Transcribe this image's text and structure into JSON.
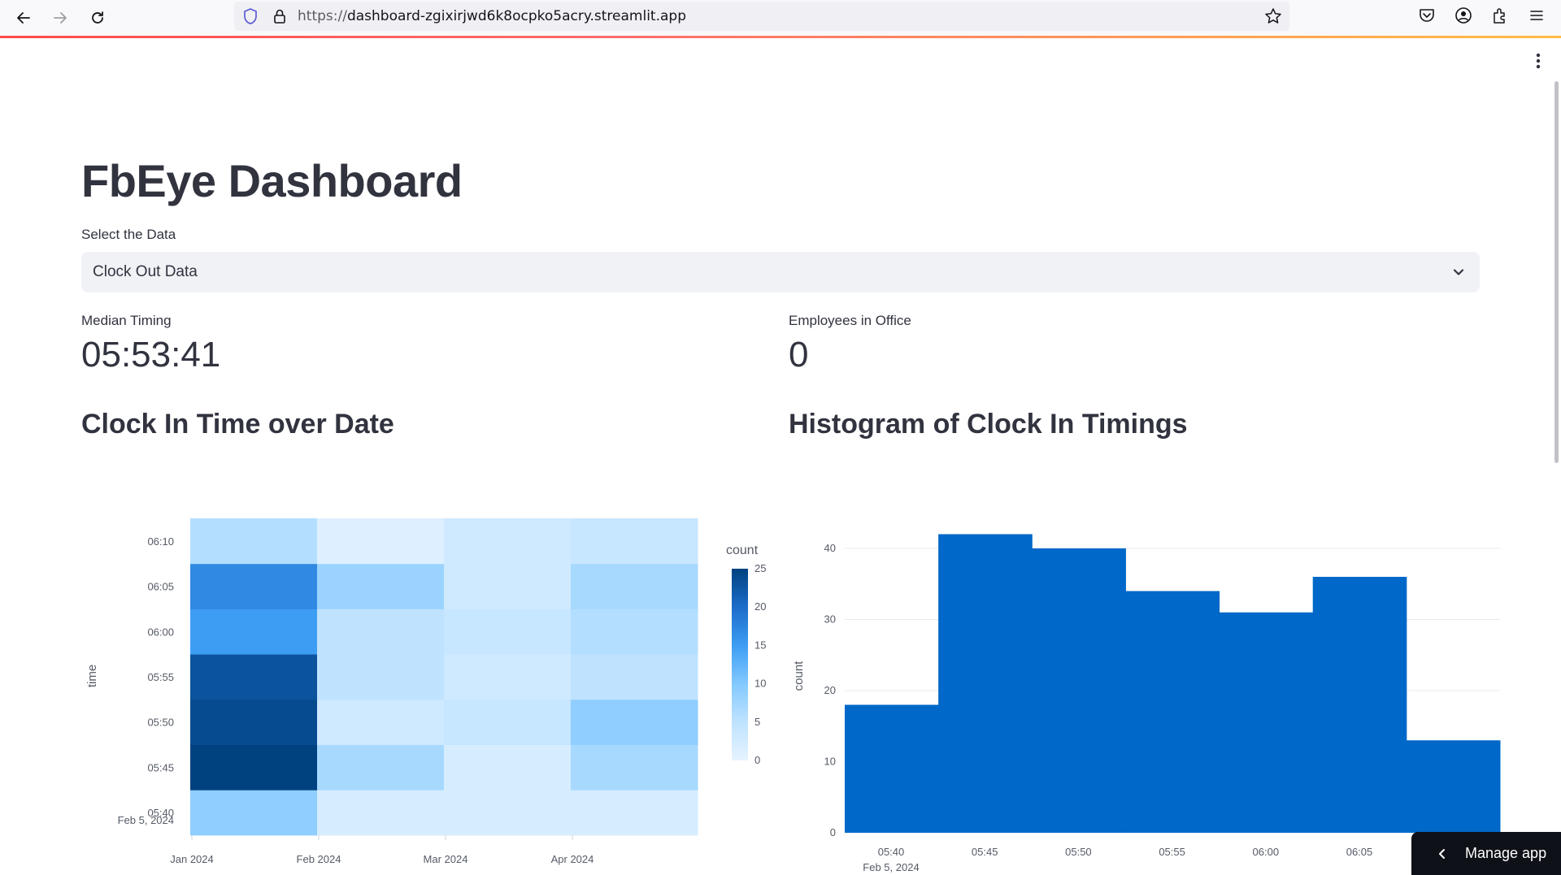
{
  "browser": {
    "url_protocol": "https://",
    "url_host": "dashboard-zgixirjwd6k8ocpko5acry.streamlit.app"
  },
  "app": {
    "title": "FbEye Dashboard",
    "select": {
      "label": "Select the Data",
      "value": "Clock Out Data"
    },
    "metrics": [
      {
        "label": "Median Timing",
        "value": "05:53:41"
      },
      {
        "label": "Employees in Office",
        "value": "0"
      }
    ],
    "sections": [
      {
        "title": "Clock In Time over Date"
      },
      {
        "title": "Histogram of Clock In Timings"
      }
    ],
    "manage_app_label": "Manage app"
  },
  "colors": {
    "accent": "#0068c9",
    "text": "#31333f",
    "streamlit_red": "#ff4b4b"
  },
  "icons": [
    "back-arrow-icon",
    "forward-arrow-icon",
    "reload-icon",
    "shield-icon",
    "lock-icon",
    "star-icon",
    "pocket-icon",
    "account-icon",
    "extensions-icon",
    "menu-icon",
    "kebab-menu-icon",
    "chevron-down-icon",
    "chevron-left-icon"
  ],
  "chart_data": [
    {
      "type": "heatmap",
      "xlabel": "",
      "ylabel": "time",
      "x_ticks": [
        "Jan 2024",
        "Feb 2024",
        "Mar 2024",
        "Apr 2024"
      ],
      "y_ticks": [
        "05:40",
        "05:45",
        "05:50",
        "05:55",
        "06:00",
        "06:05",
        "06:10"
      ],
      "y_tick_sub": "Feb 5, 2024",
      "colorbar_title": "count",
      "colorbar_ticks": [
        0,
        5,
        10,
        15,
        20,
        25
      ],
      "zmin": 0,
      "zmax": 25,
      "z": [
        [
          9,
          2,
          2,
          2
        ],
        [
          25,
          7,
          2,
          7
        ],
        [
          24,
          3,
          4,
          9
        ],
        [
          23,
          5,
          3,
          5
        ],
        [
          15,
          5,
          4,
          6
        ],
        [
          17,
          8,
          3,
          7
        ],
        [
          6,
          1,
          3,
          4
        ]
      ]
    },
    {
      "type": "bar",
      "xlabel": "",
      "ylabel": "count",
      "x_ticks": [
        "05:40",
        "05:45",
        "05:50",
        "05:55",
        "06:00",
        "06:05"
      ],
      "x_tick_sub": "Feb 5, 2024",
      "y_ticks": [
        0,
        10,
        20,
        30,
        40
      ],
      "ylim": [
        0,
        44
      ],
      "values": [
        18,
        42,
        40,
        34,
        31,
        36,
        13
      ],
      "color": "#0068c9"
    }
  ]
}
